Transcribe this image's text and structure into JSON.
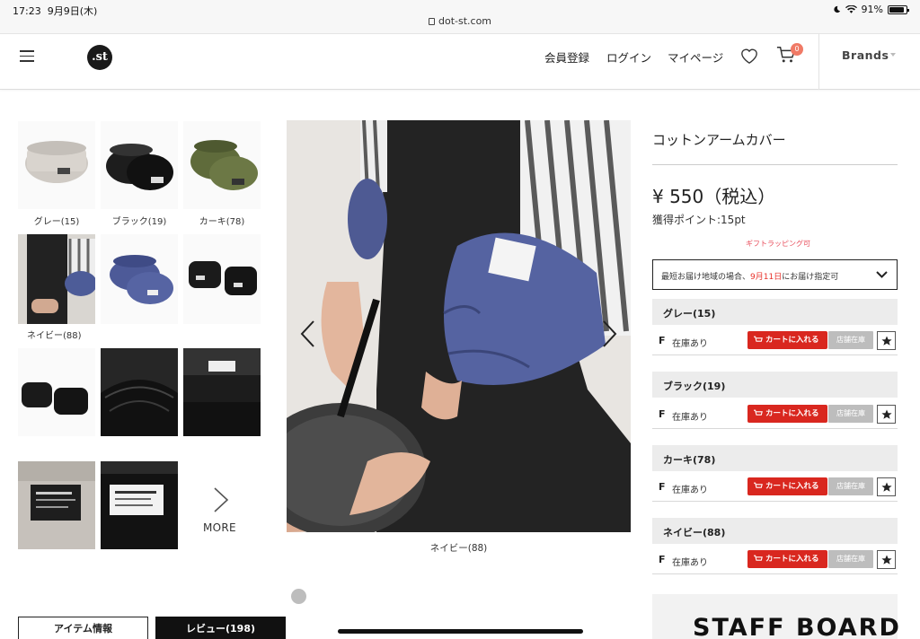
{
  "status_bar": {
    "time": "17:23",
    "date": "9月9日(木)",
    "url": "dot-st.com",
    "battery": "91%",
    "battery_level": 0.91
  },
  "header": {
    "logo": ".st",
    "nav": [
      "会員登録",
      "ログイン",
      "マイページ"
    ],
    "cart_count": "0",
    "brands": "Brands"
  },
  "thumbnails": {
    "labels": [
      "グレー(15)",
      "ブラック(19)",
      "カーキ(78)",
      "ネイビー(88)"
    ],
    "more": "MORE"
  },
  "main_image": {
    "caption": "ネイビー(88)"
  },
  "tabs": {
    "item_info": "アイテム情報",
    "review": "レビュー(198)"
  },
  "product": {
    "title": "コットンアームカバー",
    "price": "¥ 550（税込）",
    "points": "獲得ポイント:15pt",
    "gift": "ギフトラッピング可",
    "delivery_prefix": "最短お届け地域の場合、",
    "delivery_date": "9月11日",
    "delivery_suffix": "にお届け指定可"
  },
  "variants": [
    {
      "name": "グレー(15)",
      "size": "F",
      "stock": "在庫あり",
      "cart": "カートに入れる",
      "store": "店舗在庫"
    },
    {
      "name": "ブラック(19)",
      "size": "F",
      "stock": "在庫あり",
      "cart": "カートに入れる",
      "store": "店舗在庫"
    },
    {
      "name": "カーキ(78)",
      "size": "F",
      "stock": "在庫あり",
      "cart": "カートに入れる",
      "store": "店舗在庫"
    },
    {
      "name": "ネイビー(88)",
      "size": "F",
      "stock": "在庫あり",
      "cart": "カートに入れる",
      "store": "店舗在庫"
    }
  ],
  "staff_board": "STAFF BOARD",
  "colors": {
    "accent_red": "#d9271f",
    "gift_pink": "#e84d5b",
    "badge": "#f07a66"
  }
}
